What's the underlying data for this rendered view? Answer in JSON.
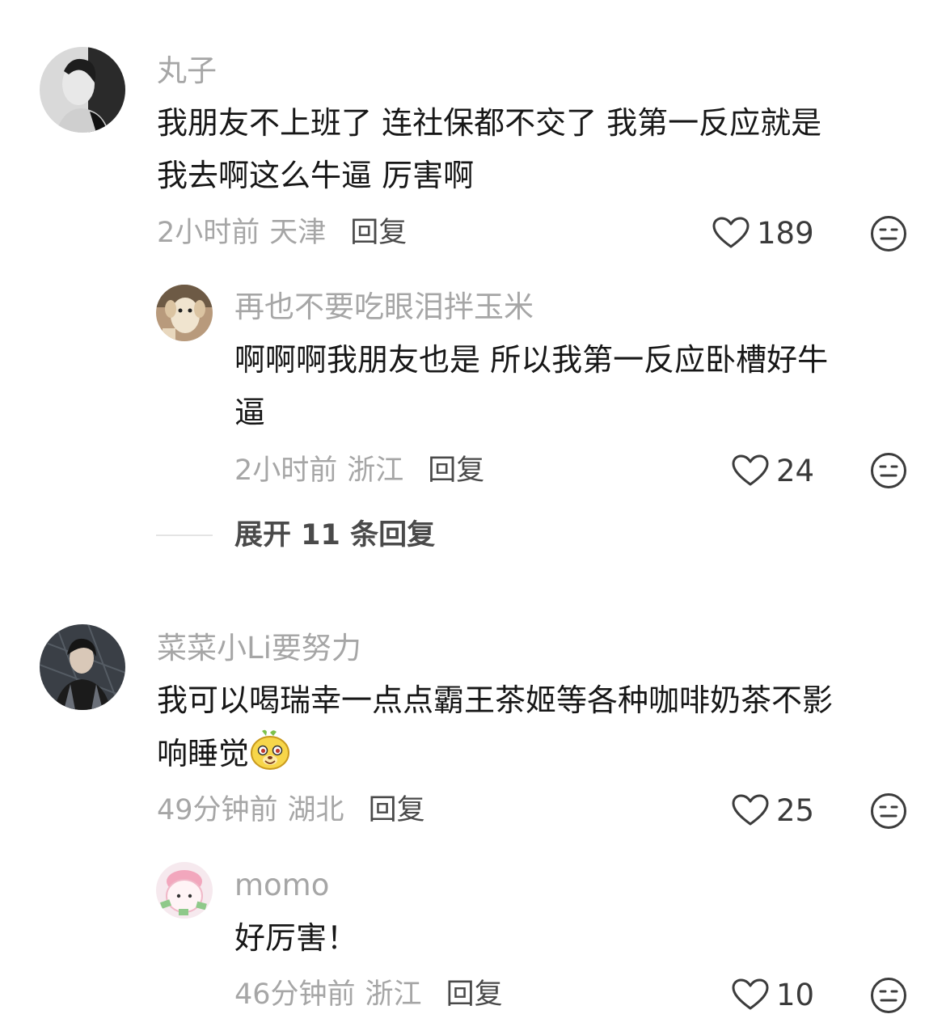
{
  "comments": [
    {
      "user": "丸子",
      "lines": [
        "我朋友不上班了 连社保都不交了 我第一反应就是",
        "我去啊这么牛逼 厉害啊"
      ],
      "time": "2小时前",
      "location": "天津",
      "reply_label": "回复",
      "likes": "189",
      "replies": [
        {
          "user": "再也不要吃眼泪拌玉米",
          "lines": [
            "啊啊啊我朋友也是 所以我第一反应卧槽好牛",
            "逼"
          ],
          "time": "2小时前",
          "location": "浙江",
          "reply_label": "回复",
          "likes": "24"
        }
      ],
      "expand_label": "展开 11 条回复"
    },
    {
      "user": "菜菜小Li要努力",
      "lines": [
        "我可以喝瑞幸一点点霸王茶姬等各种咖啡奶茶不影",
        "响睡觉"
      ],
      "time": "49分钟前",
      "location": "湖北",
      "reply_label": "回复",
      "likes": "25",
      "replies": [
        {
          "user": "momo",
          "lines": [
            "好厉害！"
          ],
          "time": "46分钟前",
          "location": "浙江",
          "reply_label": "回复",
          "likes": "10"
        }
      ]
    }
  ],
  "icons": {
    "like": "heart-outline-icon",
    "dislike": "meh-face-icon",
    "emoji": "yellow-dog-emoji"
  },
  "colors": {
    "username": "#a6a6a6",
    "text": "#171717",
    "meta": "#a6a6a6",
    "reply": "#4a4a4a"
  }
}
